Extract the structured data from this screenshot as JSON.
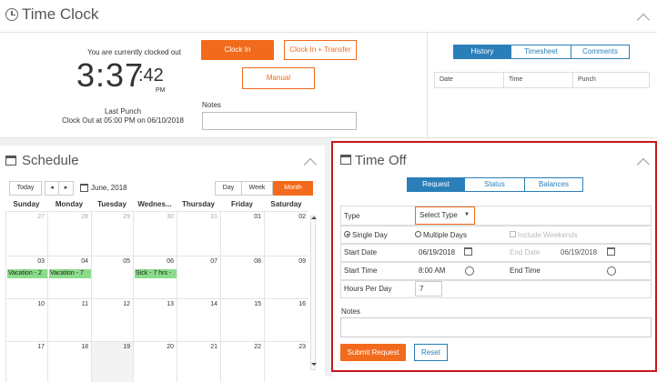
{
  "time_clock": {
    "title": "Time Clock",
    "status_text": "You are currently clocked out",
    "time_hm": "3:37",
    "time_sec": ":42",
    "ampm": "PM",
    "last_punch_label": "Last Punch",
    "last_punch_value": "Clock Out at 05:00 PM on 06/10/2018",
    "clock_in_label": "Clock In",
    "clock_in_transfer_label": "Clock In + Transfer",
    "manual_label": "Manual",
    "notes_label": "Notes",
    "notes_value": ""
  },
  "history": {
    "tabs": [
      "History",
      "Timesheet",
      "Comments"
    ],
    "active_tab": "History",
    "columns": [
      "Date",
      "Time",
      "Punch"
    ]
  },
  "schedule": {
    "title": "Schedule",
    "today_label": "Today",
    "prev_label": "◂",
    "next_label": "▸",
    "month_label": "June, 2018",
    "views": [
      "Day",
      "Week",
      "Month"
    ],
    "active_view": "Month",
    "day_names": [
      "Sunday",
      "Monday",
      "Tuesday",
      "Wednes...",
      "Thursday",
      "Friday",
      "Saturday"
    ],
    "weeks": [
      [
        {
          "d": "27",
          "o": true
        },
        {
          "d": "28",
          "o": true
        },
        {
          "d": "29",
          "o": true
        },
        {
          "d": "30",
          "o": true
        },
        {
          "d": "31",
          "o": true
        },
        {
          "d": "01"
        },
        {
          "d": "02"
        }
      ],
      [
        {
          "d": "03",
          "e": "Vacation - 2"
        },
        {
          "d": "04",
          "e": "Vacation - 7"
        },
        {
          "d": "05"
        },
        {
          "d": "06",
          "e": "Sick - 7 hrs -"
        },
        {
          "d": "07"
        },
        {
          "d": "08"
        },
        {
          "d": "09"
        }
      ],
      [
        {
          "d": "10"
        },
        {
          "d": "11"
        },
        {
          "d": "12"
        },
        {
          "d": "13"
        },
        {
          "d": "14"
        },
        {
          "d": "15"
        },
        {
          "d": "16"
        }
      ],
      [
        {
          "d": "17"
        },
        {
          "d": "18"
        },
        {
          "d": "19",
          "t": true
        },
        {
          "d": "20"
        },
        {
          "d": "21"
        },
        {
          "d": "22"
        },
        {
          "d": "23"
        }
      ]
    ]
  },
  "time_off": {
    "title": "Time Off",
    "tabs": [
      "Request",
      "Status",
      "Balances"
    ],
    "active_tab": "Request",
    "type_label": "Type",
    "type_select": "Select Type",
    "single_day_label": "Single Day",
    "multiple_days_label": "Multiple Days",
    "include_weekends_label": "Include Weekends",
    "start_date_label": "Start Date",
    "start_date_value": "06/19/2018",
    "end_date_label": "End Date",
    "end_date_value": "06/19/2018",
    "start_time_label": "Start Time",
    "start_time_value": "8:00 AM",
    "end_time_label": "End Time",
    "end_time_value": "",
    "hours_label": "Hours Per Day",
    "hours_value": "7",
    "notes_label": "Notes",
    "notes_value": "",
    "submit_label": "Submit Request",
    "reset_label": "Reset"
  },
  "colors": {
    "accent": "#f26a1b",
    "tab_blue": "#2a7fb8",
    "highlight_border": "#c8161d",
    "event_green": "#8bdc8a"
  }
}
